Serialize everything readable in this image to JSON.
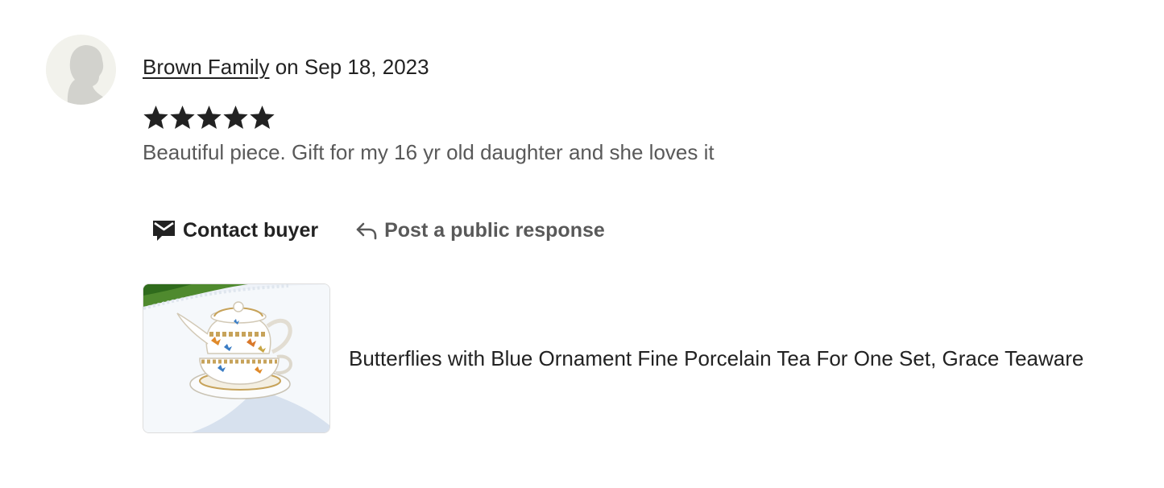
{
  "review": {
    "reviewer_name": "Brown Family",
    "date_prefix": "on",
    "date": "Sep 18, 2023",
    "rating": 5,
    "rating_max": 5,
    "text": "Beautiful piece. Gift for my 16 yr old daughter and she loves it"
  },
  "actions": {
    "contact_label": "Contact buyer",
    "contact_icon": "envelope-icon",
    "respond_label": "Post a public response",
    "respond_icon": "reply-arrow-icon"
  },
  "listing": {
    "title": "Butterflies with Blue Ornament Fine Porcelain Tea For One Set, Grace Teaware"
  },
  "colors": {
    "primary_text": "#222222",
    "secondary_text": "#595959",
    "star": "#222222",
    "avatar_bg": "#f2f2ec"
  }
}
